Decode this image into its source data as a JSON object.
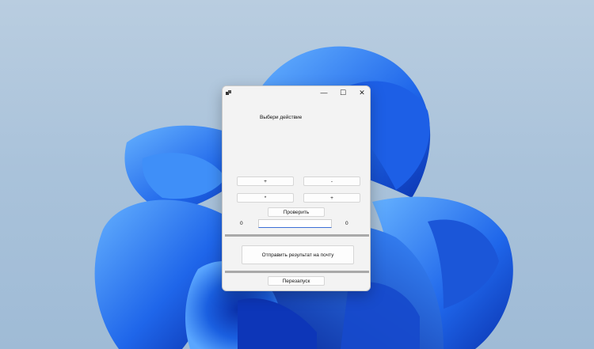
{
  "window": {
    "action_prompt": "Выбери действие",
    "ops": {
      "add": "+",
      "subtract": "-",
      "multiply": "*",
      "divide": "+"
    },
    "check_label": "Проверить",
    "left_operand": "0",
    "right_operand": "0",
    "answer_value": "",
    "send_label": "Отправить результат на почту",
    "restart_label": "Перезапуск"
  },
  "titlebar": {
    "minimize_glyph": "—",
    "maximize_glyph": "☐",
    "close_glyph": "✕"
  },
  "colors": {
    "wallpaper_bg": "#b3c9de",
    "bloom_blue": "#1a5fe0",
    "window_bg": "#f3f3f3",
    "separator": "#a9a9a9",
    "input_focus": "#3b6fd6"
  }
}
